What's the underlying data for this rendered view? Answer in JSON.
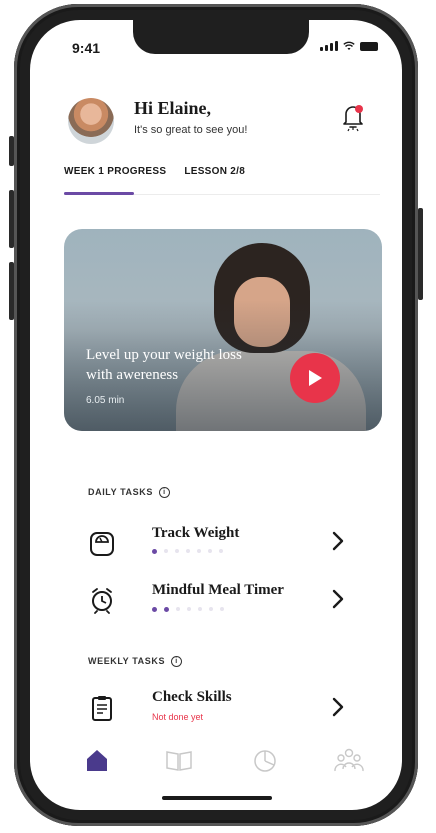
{
  "status_bar": {
    "time": "9:41"
  },
  "header": {
    "greeting": "Hi Elaine,",
    "subtitle": "It's so great to see you!"
  },
  "tabs": [
    {
      "label": "WEEK 1 PROGRESS",
      "active": true
    },
    {
      "label": "LESSON 2/8",
      "active": false
    }
  ],
  "video": {
    "title": "Level up your weight loss with awereness",
    "duration": "6.05 min"
  },
  "daily_tasks": {
    "label": "DAILY TASKS",
    "items": [
      {
        "title": "Track Weight",
        "icon": "scale-icon",
        "progress_filled": 1,
        "progress_total": 7
      },
      {
        "title": "Mindful Meal Timer",
        "icon": "alarm-clock-icon",
        "progress_filled": 2,
        "progress_total": 7
      }
    ]
  },
  "weekly_tasks": {
    "label": "WEEKLY TASKS",
    "items": [
      {
        "title": "Check Skills",
        "icon": "clipboard-icon",
        "status": "Not done yet"
      }
    ]
  },
  "bottom_nav": {
    "items": [
      {
        "name": "home",
        "icon": "home-icon",
        "active": true
      },
      {
        "name": "lessons",
        "icon": "book-icon",
        "active": false
      },
      {
        "name": "progress",
        "icon": "pie-chart-icon",
        "active": false
      },
      {
        "name": "community",
        "icon": "people-icon",
        "active": false
      }
    ]
  },
  "colors": {
    "accent": "#6b4aa5",
    "play_button": "#e8344a",
    "home_active": "#4a3a8c"
  }
}
